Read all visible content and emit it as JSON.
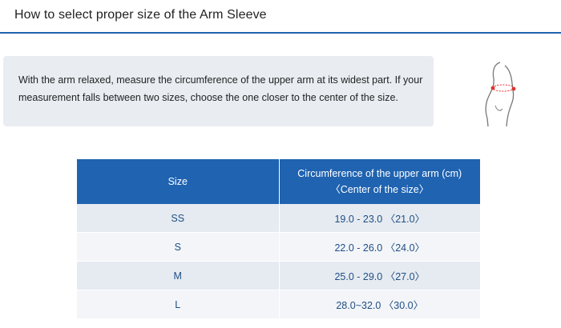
{
  "page": {
    "title": "How to select proper size of the Arm Sleeve"
  },
  "instructions": {
    "text": "With the arm relaxed, measure the circumference of the upper arm at its widest part. If your measurement falls between two sizes, choose the one closer to the center of the size."
  },
  "illustration": {
    "icon": "arm-measurement-icon"
  },
  "size_table": {
    "header_size": "Size",
    "header_circumference": "Circumference of the upper arm (cm)",
    "header_center": "〈Center of the size〉",
    "rows": [
      {
        "size": "SS",
        "range": "19.0 - 23.0 〈21.0〉"
      },
      {
        "size": "S",
        "range": "22.0 - 26.0 〈24.0〉"
      },
      {
        "size": "M",
        "range": "25.0 - 29.0 〈27.0〉"
      },
      {
        "size": "L",
        "range": "28.0~32.0 〈30.0〉"
      }
    ]
  },
  "colors": {
    "accent": "#1f63b1",
    "panel_bg": "#e9edf2",
    "cell_text": "#1f4e86",
    "marker": "#e0332e"
  }
}
